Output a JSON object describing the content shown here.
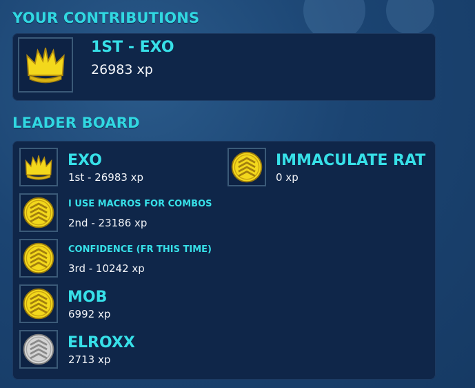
{
  "contributions": {
    "title": "YOUR CONTRIBUTIONS",
    "icon": "crown-icon",
    "rank_name": "1ST - EXO",
    "xp": "26983 xp"
  },
  "leaderboard": {
    "title": "LEADER BOARD",
    "entries": [
      {
        "name": "EXO",
        "detail": "1st - 26983 xp",
        "icon": "crown-icon"
      },
      {
        "name": "I USE MACROS FOR COMBOS",
        "detail": "2nd - 23186 xp",
        "icon": "gold-chevron-icon"
      },
      {
        "name": "CONFIDENCE (FR THIS TIME)",
        "detail": "3rd - 10242 xp",
        "icon": "gold-chevron-icon"
      },
      {
        "name": "MOB",
        "detail": "6992 xp",
        "icon": "gold-chevron-icon"
      },
      {
        "name": "ELROXX",
        "detail": "2713 xp",
        "icon": "silver-chevron-icon"
      },
      {
        "name": "IMMACULATE RAT",
        "detail": "0 xp",
        "icon": "gold-chevron-icon"
      }
    ]
  },
  "colors": {
    "accent": "#31d8e2",
    "panel": "#0f2649",
    "gold": "#f3d81c",
    "silver": "#c9c9c9"
  }
}
